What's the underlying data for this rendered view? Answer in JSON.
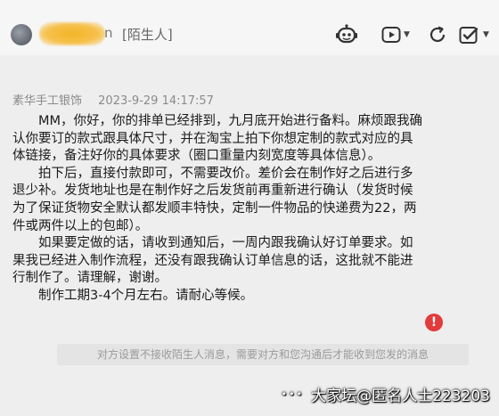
{
  "header": {
    "name_tail": "n",
    "stranger_tag": "[陌生人]",
    "icons": [
      "robot-icon",
      "video-call-icon",
      "refresh-icon",
      "checklist-icon"
    ]
  },
  "message": {
    "sender": "素华手工银饰",
    "timestamp": "2023-9-29 14:17:57",
    "paragraphs": [
      "MM，你好，你的排单已经排到，九月底开始进行备料。麻烦跟我确认你要订的款式跟具体尺寸，并在淘宝上拍下你想定制的款式对应的具体链接，备注好你的具体要求（圈口重量内刻宽度等具体信息）。",
      "拍下后，直接付款即可，不需要改价。差价会在制作好之后进行多退少补。发货地址也是在制作好之后发货前再重新进行确认（发货时候为了保证货物安全默认都发顺丰特快，定制一件物品的快递费为22，两件或两件以上的包邮）。",
      "如果要定做的话，请收到通知后，一周内跟我确认好订单要求。如果我已经进入制作流程，还没有跟我确认订单信息的话，这批就不能进行制作了。请理解，谢谢。",
      "制作工期3-4个月左右。请耐心等候。"
    ],
    "error_mark": "!"
  },
  "notice": "对方设置不接收陌生人消息，需要对方和您沟通后才能收到您发的消息",
  "watermark": {
    "dots": "•••",
    "text": "大家坛@匿名人士223203"
  },
  "colors": {
    "background": "#eeeeee",
    "error": "#e23b3b",
    "name_highlight": "#f3b429"
  }
}
